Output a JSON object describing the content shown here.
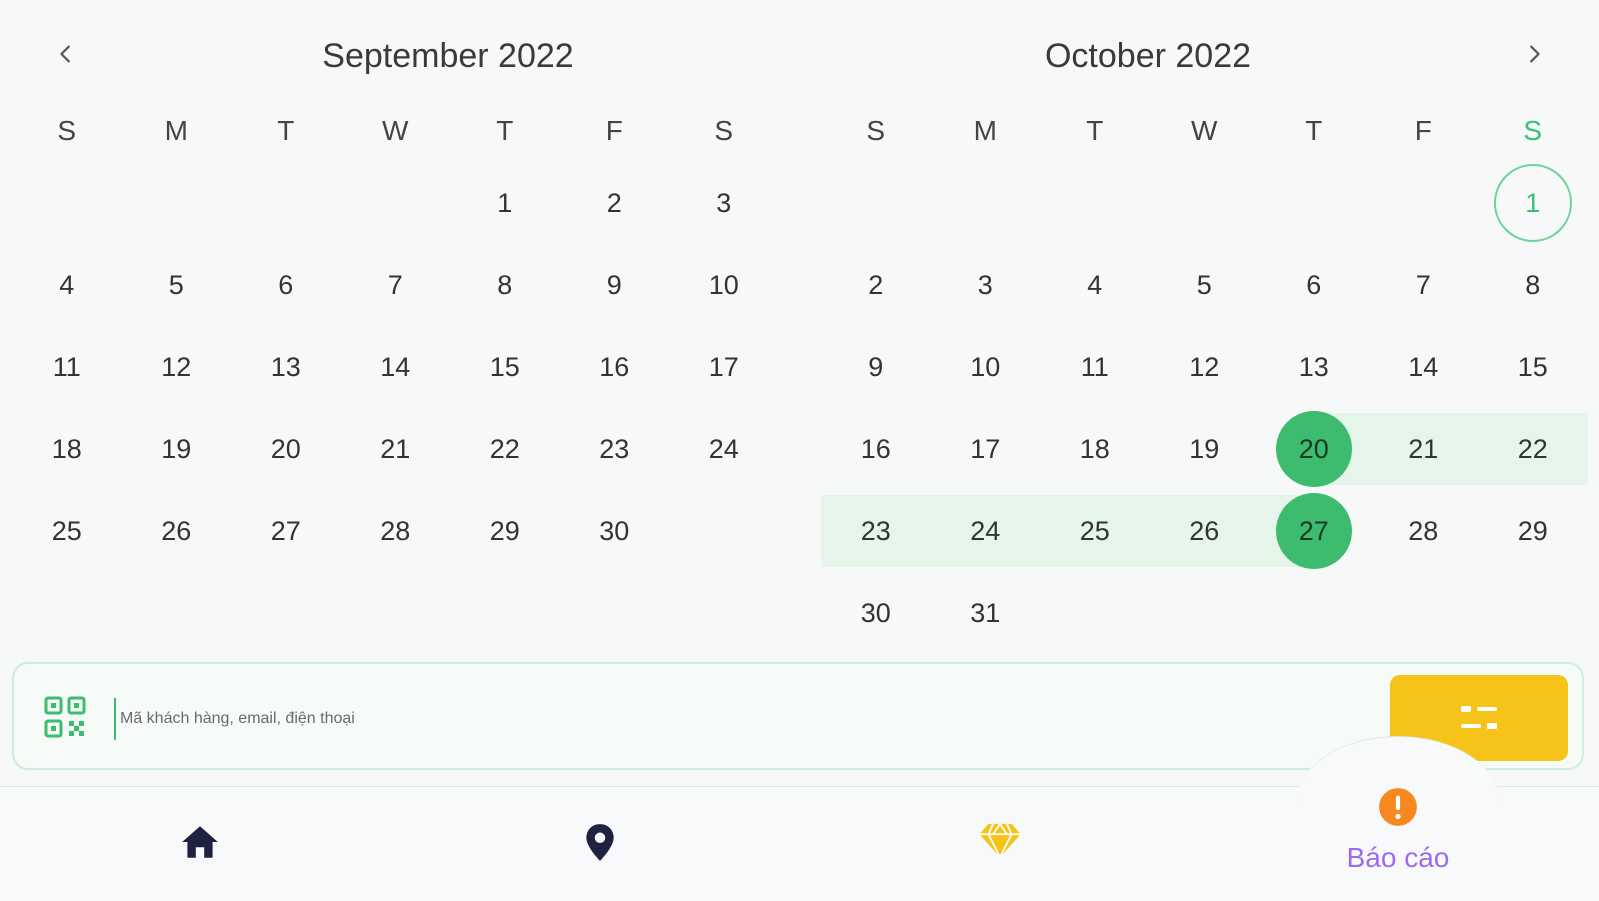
{
  "calendar": {
    "left_month": "September 2022",
    "right_month": "October 2022",
    "weekdays": [
      "S",
      "M",
      "T",
      "W",
      "T",
      "F",
      "S"
    ],
    "sep": {
      "w1": [
        "",
        "",
        "",
        "",
        "1",
        "2",
        "3"
      ],
      "w2": [
        "4",
        "5",
        "6",
        "7",
        "8",
        "9",
        "10"
      ],
      "w3": [
        "11",
        "12",
        "13",
        "14",
        "15",
        "16",
        "17"
      ],
      "w4": [
        "18",
        "19",
        "20",
        "21",
        "22",
        "23",
        "24"
      ],
      "w5": [
        "25",
        "26",
        "27",
        "28",
        "29",
        "30",
        ""
      ]
    },
    "oct": {
      "w1": [
        "",
        "",
        "",
        "",
        "",
        "",
        "1"
      ],
      "w2": [
        "2",
        "3",
        "4",
        "5",
        "6",
        "7",
        "8"
      ],
      "w3": [
        "9",
        "10",
        "11",
        "12",
        "13",
        "14",
        "15"
      ],
      "w4": [
        "16",
        "17",
        "18",
        "19",
        "20",
        "21",
        "22"
      ],
      "w5": [
        "23",
        "24",
        "25",
        "26",
        "27",
        "28",
        "29"
      ],
      "w6": [
        "30",
        "31",
        "",
        "",
        "",
        "",
        ""
      ]
    },
    "today": "1",
    "range_start": "20",
    "range_end": "27"
  },
  "search": {
    "placeholder": "Mã khách hàng, email, điện thoại",
    "value": ""
  },
  "nav": {
    "items": [
      {
        "icon": "home-icon"
      },
      {
        "icon": "location-pin-icon"
      },
      {
        "icon": "diamond-icon"
      },
      {
        "icon": "alert-icon",
        "label": "Báo cáo"
      }
    ]
  },
  "colors": {
    "accent_green": "#3dbb6e",
    "range_bg": "#e6f5ea",
    "filter_yellow": "#f6c419",
    "active_label": "#9b6bf0",
    "alert_orange": "#f5891f",
    "diamond_yellow": "#f6c419",
    "nav_dark": "#1f2140"
  }
}
